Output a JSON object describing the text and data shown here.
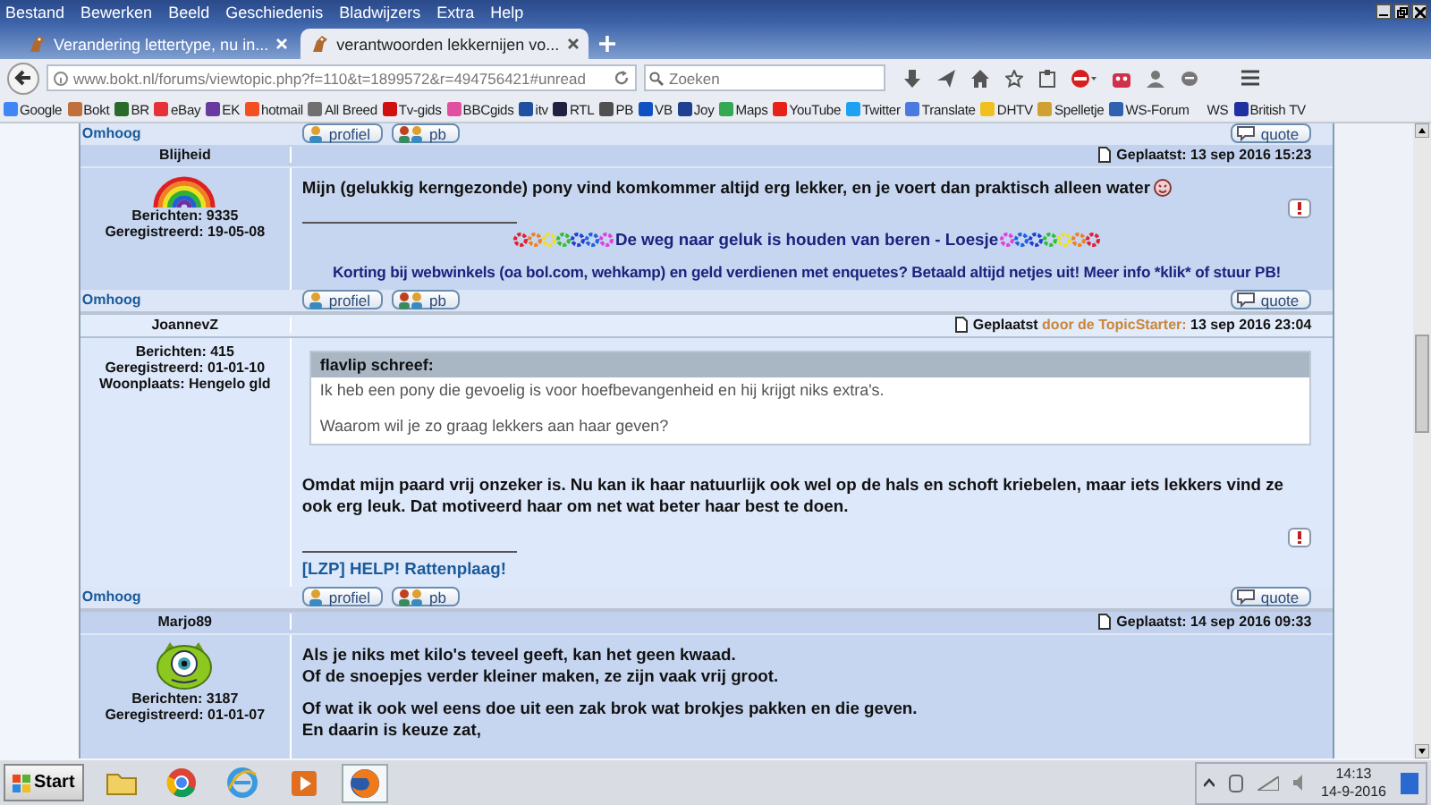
{
  "menu": [
    "Bestand",
    "Bewerken",
    "Beeld",
    "Geschiedenis",
    "Bladwijzers",
    "Extra",
    "Help"
  ],
  "tabs": [
    {
      "title": "Verandering lettertype, nu in...",
      "selected": false
    },
    {
      "title": "verantwoorden lekkernijen vo...",
      "selected": true
    }
  ],
  "address": {
    "url": "www.bokt.nl/forums/viewtopic.php?f=110&t=1899572&r=494756421#unread"
  },
  "search": {
    "placeholder": "Zoeken"
  },
  "bookmarks": [
    {
      "label": "Google",
      "color": "#4285f4"
    },
    {
      "label": "Bokt",
      "color": "#c0703a"
    },
    {
      "label": "BR",
      "color": "#2a6a2a"
    },
    {
      "label": "eBay",
      "color": "#e53238"
    },
    {
      "label": "EK",
      "color": "#6a3aa0"
    },
    {
      "label": "hotmail",
      "color": "#f25022"
    },
    {
      "label": "All Breed",
      "color": "#707070"
    },
    {
      "label": "Tv-gids",
      "color": "#d01010"
    },
    {
      "label": "BBCgids",
      "color": "#e050a0"
    },
    {
      "label": "itv",
      "color": "#2050a0"
    },
    {
      "label": "RTL",
      "color": "#202040"
    },
    {
      "label": "PB",
      "color": "#505050"
    },
    {
      "label": "VB",
      "color": "#1050c0"
    },
    {
      "label": "Joy",
      "color": "#204090"
    },
    {
      "label": "Maps",
      "color": "#34a853"
    },
    {
      "label": "YouTube",
      "color": "#e62117"
    },
    {
      "label": "Twitter",
      "color": "#1da1f2"
    },
    {
      "label": "Translate",
      "color": "#4a7ae0"
    },
    {
      "label": "DHTV",
      "color": "#f0c020"
    },
    {
      "label": "Spelletje",
      "color": "#d0a030"
    },
    {
      "label": "WS-Forum",
      "color": "#3060b0"
    },
    {
      "label": "WS"
    },
    {
      "label": "British TV",
      "color": "#2030a0"
    }
  ],
  "previous_footer": {
    "back_link": "Omhoog",
    "profile": "profiel",
    "pm": "pb",
    "quote": "quote"
  },
  "posts": [
    {
      "author": "Blijheid",
      "posted": "Geplaatst:",
      "date": "13 sep 2016 15:23",
      "avatar": {
        "kind": "rainbow"
      },
      "report": true,
      "stats": [
        "Berichten: 9335",
        "Geregistreerd: 19-05-08"
      ],
      "blocks": [
        {
          "kind": "text",
          "lines": [
            "Mijn (gelukkig kerngezonde) pony vind komkommer altijd erg lekker, en je voert dan praktisch alleen water"
          ],
          "emoticon": true
        },
        {
          "kind": "rule"
        },
        {
          "kind": "motto",
          "text": "De weg naar geluk is houden van beren - Loesje"
        },
        {
          "kind": "promo",
          "text": "Korting bij webwinkels (oa bol.com, wehkamp) en geld verdienen met enquetes? Betaald altijd netjes uit! Meer info *klik* of stuur PB!"
        }
      ],
      "footer": {
        "back_link": "Omhoog",
        "profile": "profiel",
        "pm": "pb",
        "quote": "quote"
      }
    },
    {
      "author": "JoannevZ",
      "posted": "Geplaatst",
      "starter": "door de TopicStarter:",
      "date": "13 sep 2016 23:04",
      "report": true,
      "stats": [
        "Berichten: 415",
        "Geregistreerd: 01-01-10",
        "Woonplaats: Hengelo gld"
      ],
      "blocks": [
        {
          "kind": "quote",
          "author": "flavlip schreef:",
          "paragraphs": [
            "Ik heb een pony die gevoelig is voor hoefbevangenheid en hij krijgt niks extra's.",
            "Waarom wil je zo graag lekkers aan haar geven?"
          ]
        },
        {
          "kind": "text",
          "lines": [
            "Omdat mijn paard vrij onzeker is. Nu kan ik haar natuurlijk ook wel op de hals en schoft kriebelen, maar iets lekkers vind ze ook erg leuk. Dat motiveerd haar om net wat beter haar best te doen."
          ],
          "emoticon": false
        },
        {
          "kind": "rule"
        },
        {
          "kind": "link",
          "text": "[LZP] HELP! Rattenplaag!"
        }
      ],
      "footer": {
        "back_link": "Omhoog",
        "profile": "profiel",
        "pm": "pb",
        "quote": "quote"
      }
    },
    {
      "author": "Marjo89",
      "posted": "Geplaatst:",
      "date": "14 sep 2016 09:33",
      "avatar": {
        "kind": "monster"
      },
      "report": false,
      "stats": [
        "Berichten: 3187",
        "Geregistreerd: 01-01-07"
      ],
      "blocks": [
        {
          "kind": "text",
          "lines": [
            "Als je niks met kilo's teveel geeft, kan het geen kwaad.",
            "Of de snoepjes verder kleiner maken, ze zijn vaak vrij groot."
          ],
          "emoticon": false
        },
        {
          "kind": "text",
          "lines": [
            "Of wat ik ook wel eens doe uit een zak brok wat brokjes pakken en die geven.",
            "En daarin is keuze zat,"
          ],
          "emoticon": false
        }
      ]
    }
  ],
  "taskbar": {
    "start": "Start",
    "apps": [
      {
        "kind": "folder",
        "selected": false
      },
      {
        "kind": "ring",
        "selected": false
      },
      {
        "kind": "letter-e",
        "selected": false
      },
      {
        "kind": "player",
        "selected": false
      },
      {
        "kind": "fox",
        "selected": true
      }
    ],
    "time": "14:13",
    "date": "14-9-2016"
  }
}
